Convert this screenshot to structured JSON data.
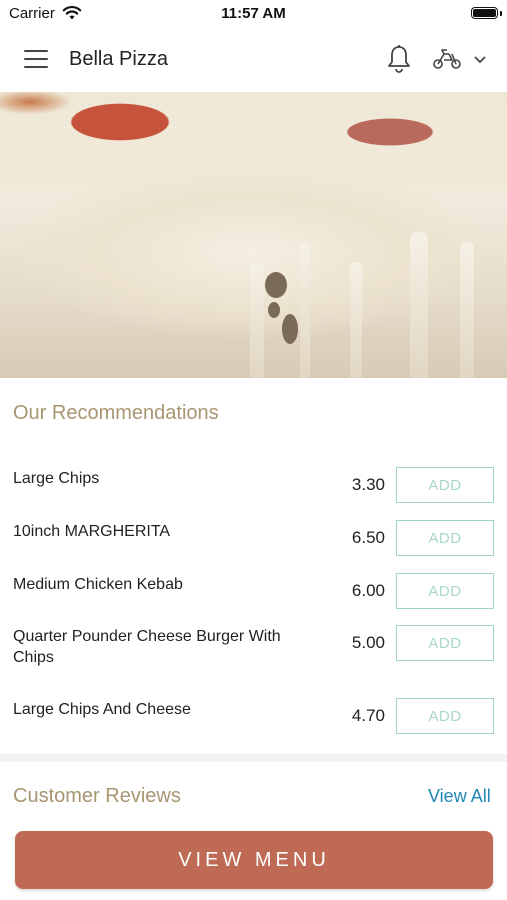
{
  "status": {
    "carrier": "Carrier",
    "time": "11:57 AM"
  },
  "header": {
    "title": "Bella Pizza"
  },
  "recommendations": {
    "title": "Our Recommendations",
    "items": [
      {
        "name": "Large Chips",
        "price": "3.30",
        "add_label": "ADD"
      },
      {
        "name": "10inch MARGHERITA",
        "price": "6.50",
        "add_label": "ADD"
      },
      {
        "name": "Medium Chicken Kebab",
        "price": "6.00",
        "add_label": "ADD"
      },
      {
        "name": "Quarter Pounder Cheese Burger With Chips",
        "price": "5.00",
        "add_label": "ADD"
      },
      {
        "name": "Large Chips And Cheese",
        "price": "4.70",
        "add_label": "ADD"
      }
    ]
  },
  "reviews": {
    "title": "Customer Reviews",
    "view_all": "View All"
  },
  "footer": {
    "view_menu_label": "VIEW MENU"
  },
  "colors": {
    "accent": "#bf6a54",
    "section_title": "#a89572",
    "link": "#1f87b5",
    "add_border": "#9fd6bd"
  },
  "icons": [
    "wifi-icon",
    "battery-icon",
    "menu-icon",
    "bell-icon",
    "scooter-icon",
    "chevron-down-icon"
  ]
}
